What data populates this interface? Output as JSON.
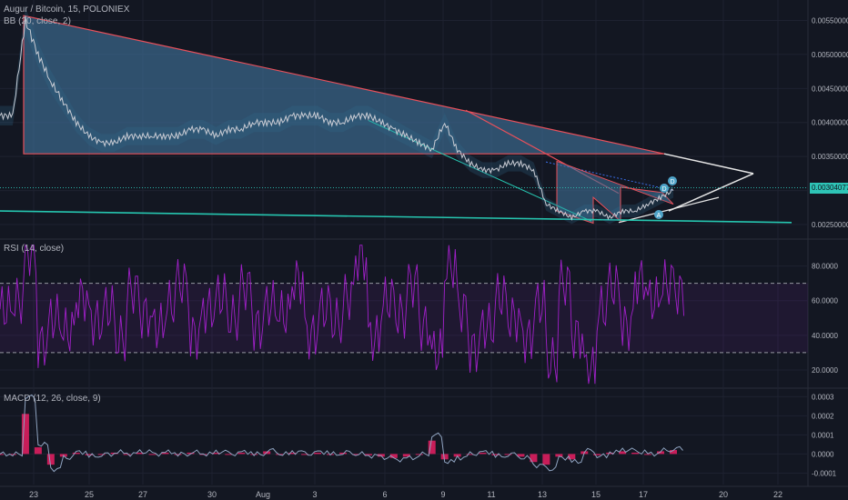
{
  "header": {
    "symbol_line": "Augur / Bitcoin, 15, POLONIEX",
    "bb_line": "BB (20, close, 2)",
    "rsi_line": "RSI (14, close)",
    "macd_line": "MACD (12, 26, close, 9)"
  },
  "colors": {
    "background": "#131722",
    "grid": "#1e2230",
    "price": "#c9ccd4",
    "bb_band": "#2f6b8f",
    "triangle_fill": "#3f6f96",
    "triangle_edge": "#e8505b",
    "teal_line": "#26c6b0",
    "white_line": "#e6e6e6",
    "rsi": "#a020c8",
    "macd_line": "#8fa3c0",
    "macd_hist": "#e91e63",
    "last_price_badge": "#2ec4b6"
  },
  "chart_data": [
    {
      "type": "line",
      "title": "Augur / Bitcoin, 15, POLONIEX",
      "indicator": "BB (20, close, 2)",
      "y_ticks": [
        "0.00550000",
        "0.00500000",
        "0.00450000",
        "0.00400000",
        "0.00350000",
        "0.00300000",
        "0.00250000"
      ],
      "ylim": [
        0.0023,
        0.0058
      ],
      "x_ticks": [
        "23",
        "25",
        "27",
        "30",
        "Aug",
        "3",
        "6",
        "9",
        "11",
        "13",
        "15",
        "17",
        "20",
        "22"
      ],
      "last_price": "0.00304077",
      "series": [
        {
          "values": [
            0.0041,
            0.0041,
            0.0055,
            0.005,
            0.0046,
            0.0043,
            0.004,
            0.0038,
            0.0037,
            0.0037,
            0.0038,
            0.0038,
            0.0038,
            0.0038,
            0.0038,
            0.0039,
            0.0039,
            0.0038,
            0.0039,
            0.0039,
            0.004,
            0.004,
            0.004,
            0.0041,
            0.0041,
            0.0041,
            0.004,
            0.004,
            0.0041,
            0.0041,
            0.004,
            0.0039,
            0.0038,
            0.0037,
            0.0036,
            0.004,
            0.0036,
            0.0034,
            0.0033,
            0.0033,
            0.0034,
            0.0034,
            0.0033,
            0.0028,
            0.0027,
            0.0026,
            0.0027,
            0.0027,
            0.0026,
            0.0027,
            0.0027,
            0.0028,
            0.0029,
            0.003
          ]
        }
      ],
      "drawings": [
        "descending triangle",
        "falling wedge",
        "trend lines"
      ],
      "pattern_labels": [
        "D",
        "D",
        "A"
      ]
    },
    {
      "type": "line",
      "title": "RSI (14, close)",
      "y_ticks": [
        "80.0000",
        "60.0000",
        "40.0000",
        "20.0000"
      ],
      "ylim": [
        10,
        95
      ],
      "levels": [
        70,
        30
      ],
      "series": [
        {
          "values": [
            55,
            60,
            88,
            35,
            50,
            42,
            62,
            48,
            55,
            38,
            66,
            52,
            45,
            58,
            70,
            40,
            55,
            62,
            50,
            68,
            45,
            58,
            52,
            72,
            40,
            55,
            48,
            62,
            85,
            38,
            60,
            52,
            70,
            45,
            30,
            80,
            55,
            32,
            45,
            62,
            50,
            38,
            58,
            25,
            70,
            40,
            20,
            55,
            68,
            45,
            72,
            60,
            70,
            65
          ]
        }
      ]
    },
    {
      "type": "line",
      "title": "MACD (12, 26, close, 9)",
      "y_ticks": [
        "0.0003",
        "0.0002",
        "0.0001",
        "0.0000",
        "-0.0001"
      ],
      "ylim": [
        -0.00016,
        0.00034
      ],
      "series": [
        {
          "name": "MACD",
          "values": [
            0.0,
            0.0,
            0.0003,
            5e-05,
            -8e-05,
            -2e-05,
            1e-05,
            -1e-05,
            0.0,
            1e-05,
            0.0,
            1e-05,
            0.0,
            1e-05,
            0.0,
            1e-05,
            0.0,
            1e-05,
            0.0,
            1e-05,
            0.0,
            2e-05,
            0.0,
            1e-05,
            0.0,
            1e-05,
            0.0,
            1e-05,
            0.0,
            -1e-05,
            -2e-05,
            -3e-05,
            -2e-05,
            0.0,
            0.0001,
            -4e-05,
            -2e-05,
            0.0,
            1e-05,
            -1e-05,
            0.0,
            -2e-05,
            -6e-05,
            -8e-05,
            -2e-05,
            -4e-05,
            2e-05,
            -1e-05,
            1e-05,
            2e-05,
            1e-05,
            0.0,
            2e-05,
            3e-05
          ]
        }
      ]
    }
  ]
}
